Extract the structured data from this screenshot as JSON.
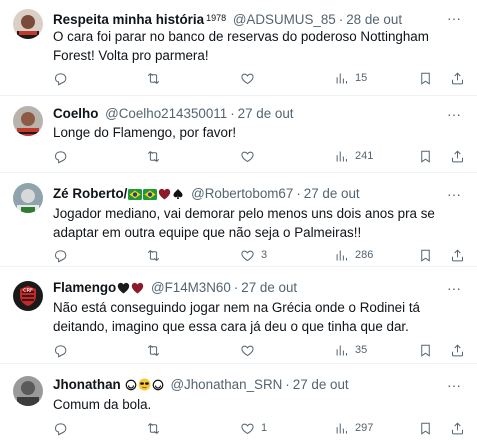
{
  "tweets": [
    {
      "name": "Respeita minha história",
      "name_suffix": "1978",
      "handle": "@ADSUMUS_85",
      "time": "28 de out",
      "text": "O cara foi parar no banco de reservas do poderoso Nottingham Forest! Volta pro parmera!",
      "reply_count": "",
      "retweet_count": "",
      "like_count": "",
      "views": "15"
    },
    {
      "name": "Coelho",
      "name_suffix": "",
      "handle": "@Coelho214350011",
      "time": "27 de out",
      "text": "Longe do Flamengo, por favor!",
      "reply_count": "",
      "retweet_count": "",
      "like_count": "",
      "views": "241"
    },
    {
      "name": "Zé Roberto/",
      "name_suffix": "",
      "handle": "@Robertobom67",
      "time": "27 de out",
      "text": "Jogador mediano, vai demorar pelo menos uns dois anos pra se adaptar em outra equipe que não seja o Palmeiras!!",
      "reply_count": "",
      "retweet_count": "",
      "like_count": "3",
      "views": "286"
    },
    {
      "name": "Flamengo",
      "name_suffix": "",
      "handle": "@F14M3N60",
      "time": "27 de out",
      "text": "Não está conseguindo jogar nem na Grécia onde o Rodinei tá deitando, imagino que essa cara já deu o que tinha que dar.",
      "reply_count": "",
      "retweet_count": "",
      "like_count": "",
      "views": "35"
    },
    {
      "name": "Jhonathan",
      "name_suffix": "",
      "handle": "@Jhonathan_SRN",
      "time": "27 de out",
      "text": "Comum da bola.",
      "reply_count": "",
      "retweet_count": "",
      "like_count": "1",
      "views": "297"
    }
  ],
  "separator": "·",
  "more_icon": "more-horizontal-icon",
  "colors": {
    "text": "#0f1419",
    "muted": "#536471",
    "divider": "#eff3f4",
    "heart": "#8b1a2b"
  }
}
